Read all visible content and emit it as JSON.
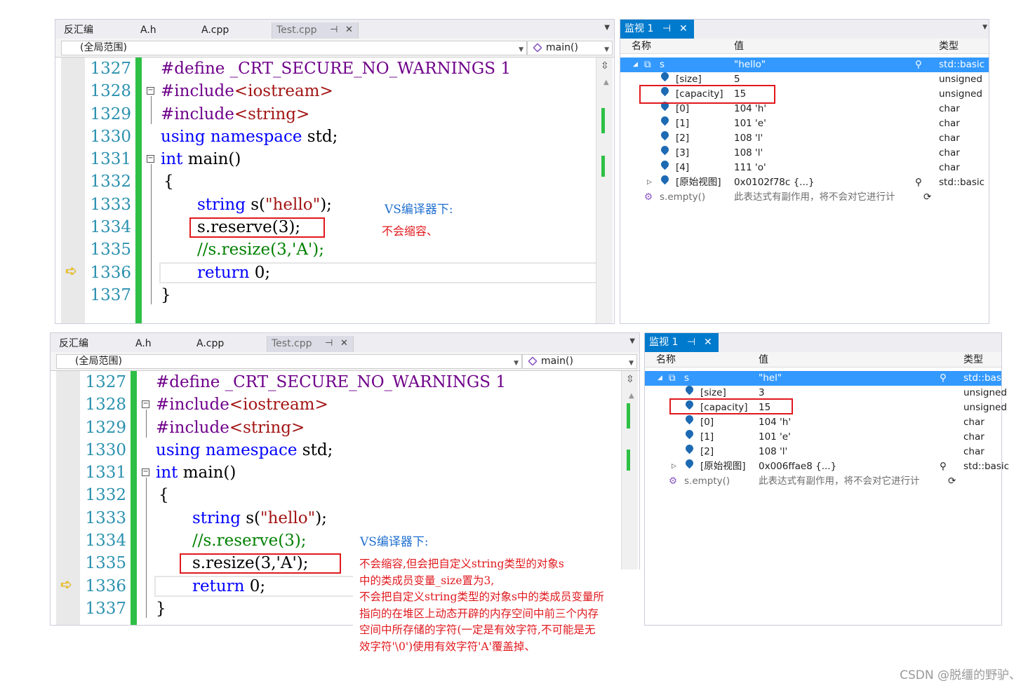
{
  "top": {
    "tabs": [
      "反汇编",
      "A.h",
      "A.cpp",
      "Test.cpp"
    ],
    "scope": "(全局范围)",
    "function": "main()",
    "line_numbers": [
      "1327",
      "1328",
      "1329",
      "1330",
      "1331",
      "1332",
      "1333",
      "1334",
      "1335",
      "1336",
      "1337"
    ],
    "code": {
      "l1327_a": "#define",
      "l1327_b": " _CRT_SECURE_NO_WARNINGS 1",
      "l1328_a": "#include",
      "l1328_b": "<iostream>",
      "l1329_a": "#include",
      "l1329_b": "<string>",
      "l1330_a": "using namespace",
      "l1330_b": " std;",
      "l1331_a": "int",
      "l1331_b": " main()",
      "l1332": "{",
      "l1333_a": "string",
      "l1333_b": " s(",
      "l1333_c": "\"hello\"",
      "l1333_d": ");",
      "l1334": "s.reserve(3);",
      "l1335": "//s.resize(3,'A');",
      "l1336_a": "return",
      "l1336_b": " 0;",
      "l1337": "}"
    },
    "annotation_1": "VS编译器下:",
    "annotation_2": "不会缩容、",
    "watch": {
      "tab": "监视 1",
      "headers": [
        "名称",
        "值",
        "类型"
      ],
      "rows": [
        {
          "name": "s",
          "value": "\"hello\"",
          "type": "std::basic"
        },
        {
          "name": "[size]",
          "value": "5",
          "type": "unsigned"
        },
        {
          "name": "[capacity]",
          "value": "15",
          "type": "unsigned"
        },
        {
          "name": "[0]",
          "value": "104 'h'",
          "type": "char"
        },
        {
          "name": "[1]",
          "value": "101 'e'",
          "type": "char"
        },
        {
          "name": "[2]",
          "value": "108 'l'",
          "type": "char"
        },
        {
          "name": "[3]",
          "value": "108 'l'",
          "type": "char"
        },
        {
          "name": "[4]",
          "value": "111 'o'",
          "type": "char"
        },
        {
          "name": "[原始视图]",
          "value": "0x0102f78c {...}",
          "type": "std::basic"
        },
        {
          "name": "s.empty()",
          "value": "此表达式有副作用，将不会对它进行计",
          "type": ""
        }
      ]
    }
  },
  "bottom": {
    "tabs": [
      "反汇编",
      "A.h",
      "A.cpp",
      "Test.cpp"
    ],
    "scope": "(全局范围)",
    "function": "main()",
    "line_numbers": [
      "1327",
      "1328",
      "1329",
      "1330",
      "1331",
      "1332",
      "1333",
      "1334",
      "1335",
      "1336",
      "1337"
    ],
    "code": {
      "l1327_a": "#define",
      "l1327_b": " _CRT_SECURE_NO_WARNINGS 1",
      "l1328_a": "#include",
      "l1328_b": "<iostream>",
      "l1329_a": "#include",
      "l1329_b": "<string>",
      "l1330_a": "using namespace",
      "l1330_b": " std;",
      "l1331_a": "int",
      "l1331_b": " main()",
      "l1332": "{",
      "l1333_a": "string",
      "l1333_b": " s(",
      "l1333_c": "\"hello\"",
      "l1333_d": ");",
      "l1334": "//s.reserve(3);",
      "l1335": "s.resize(3,'A');",
      "l1336_a": "return",
      "l1336_b": " 0;",
      "l1337": "}"
    },
    "annotation_1": "VS编译器下:",
    "annotation_2": "不会缩容,但会把自定义string类型的对象s\n中的类成员变量_size置为3,\n不会把自定义string类型的对象s中的类成员变量所\n指向的在堆区上动态开辟的内存空间中前三个内存\n空间中所存储的字符(一定是有效字符,不可能是无\n效字符'\\0')使用有效字符'A'覆盖掉、",
    "watch": {
      "tab": "监视 1",
      "headers": [
        "名称",
        "值",
        "类型"
      ],
      "rows": [
        {
          "name": "s",
          "value": "\"hel\"",
          "type": "std::basic"
        },
        {
          "name": "[size]",
          "value": "3",
          "type": "unsigned"
        },
        {
          "name": "[capacity]",
          "value": "15",
          "type": "unsigned"
        },
        {
          "name": "[0]",
          "value": "104 'h'",
          "type": "char"
        },
        {
          "name": "[1]",
          "value": "101 'e'",
          "type": "char"
        },
        {
          "name": "[2]",
          "value": "108 'l'",
          "type": "char"
        },
        {
          "name": "[原始视图]",
          "value": "0x006ffae8 {...}",
          "type": "std::basic"
        },
        {
          "name": "s.empty()",
          "value": "此表达式有副作用，将不会对它进行计",
          "type": ""
        }
      ]
    }
  },
  "watermark": "CSDN @脱缰的野驴、"
}
